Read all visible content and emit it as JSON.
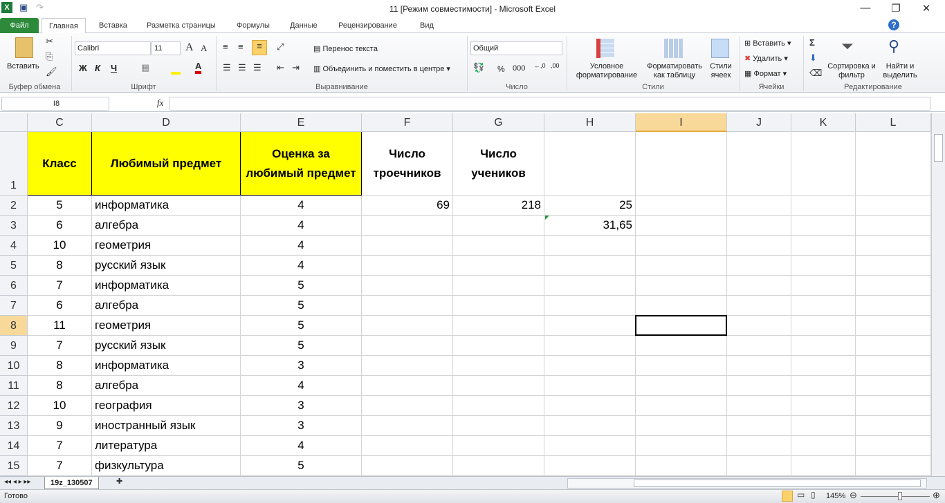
{
  "window": {
    "title": "11  [Режим совместимости]  -  Microsoft Excel",
    "minimize": "—",
    "restore": "❐",
    "close": "✕"
  },
  "tabs": [
    "Файл",
    "Главная",
    "Вставка",
    "Разметка страницы",
    "Формулы",
    "Данные",
    "Рецензирование",
    "Вид"
  ],
  "ribbon": {
    "clipboard": {
      "paste": "Вставить",
      "label": "Буфер обмена"
    },
    "font": {
      "name": "Calibri",
      "size": "11",
      "bold": "Ж",
      "italic": "К",
      "underline": "Ч",
      "label": "Шрифт"
    },
    "alignment": {
      "wrap": "Перенос текста",
      "merge": "Объединить и поместить в центре",
      "label": "Выравнивание"
    },
    "number": {
      "format": "Общий",
      "percent": "%",
      "thousands": "000",
      "label": "Число"
    },
    "styles": {
      "conditional": "Условное форматирование",
      "table": "Форматировать как таблицу",
      "cell_styles": "Стили ячеек",
      "label": "Стили"
    },
    "cells": {
      "insert": "Вставить",
      "delete": "Удалить",
      "format": "Формат",
      "label": "Ячейки"
    },
    "editing": {
      "sort": "Сортировка и фильтр",
      "find": "Найти и выделить",
      "label": "Редактирование"
    }
  },
  "formula_bar": {
    "name_box": "I8",
    "fx": "fx",
    "value": ""
  },
  "columns": [
    "C",
    "D",
    "E",
    "F",
    "G",
    "H",
    "I",
    "J",
    "K",
    "L"
  ],
  "selected": {
    "col": "I",
    "row": "8"
  },
  "header_row": {
    "row": "1",
    "C": "Класс",
    "D": "Любимый предмет",
    "E": "Оценка за любимый предмет",
    "F": "Число троечников",
    "G": "Число учеников"
  },
  "rows": [
    {
      "n": "2",
      "C": "5",
      "D": "информатика",
      "E": "4",
      "F": "69",
      "G": "218",
      "H": "25"
    },
    {
      "n": "3",
      "C": "6",
      "D": "алгебра",
      "E": "4",
      "H": "31,65"
    },
    {
      "n": "4",
      "C": "10",
      "D": "геометрия",
      "E": "4"
    },
    {
      "n": "5",
      "C": "8",
      "D": "русский язык",
      "E": "4"
    },
    {
      "n": "6",
      "C": "7",
      "D": "информатика",
      "E": "5"
    },
    {
      "n": "7",
      "C": "6",
      "D": "алгебра",
      "E": "5"
    },
    {
      "n": "8",
      "C": "11",
      "D": "геометрия",
      "E": "5"
    },
    {
      "n": "9",
      "C": "7",
      "D": "русский язык",
      "E": "5"
    },
    {
      "n": "10",
      "C": "8",
      "D": "информатика",
      "E": "3"
    },
    {
      "n": "11",
      "C": "8",
      "D": "алгебра",
      "E": "4"
    },
    {
      "n": "12",
      "C": "10",
      "D": "география",
      "E": "3"
    },
    {
      "n": "13",
      "C": "9",
      "D": "иностранный язык",
      "E": "3"
    },
    {
      "n": "14",
      "C": "7",
      "D": "литература",
      "E": "4"
    },
    {
      "n": "15",
      "C": "7",
      "D": "физкультура",
      "E": "5"
    }
  ],
  "sheet_tabs": [
    "19z_130507"
  ],
  "status": {
    "ready": "Готово",
    "zoom": "145%"
  }
}
